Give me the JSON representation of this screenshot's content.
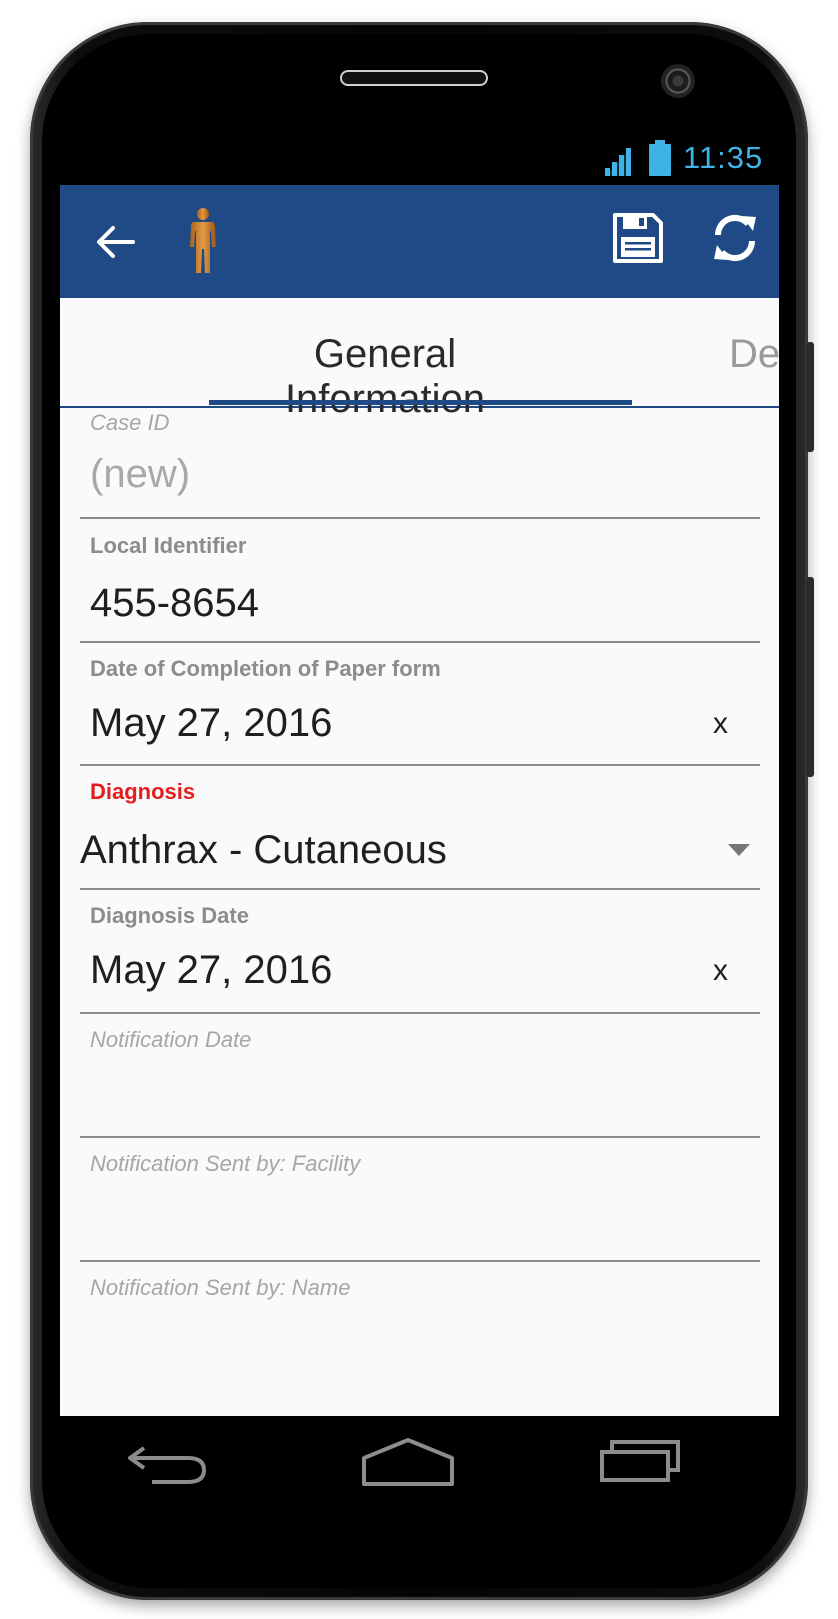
{
  "status_bar": {
    "time": "11:35",
    "time_color": "#3fb2e6"
  },
  "app_bar": {
    "color": "#204a85",
    "icons": [
      "back-arrow-icon",
      "person-icon",
      "save-icon",
      "sync-icon"
    ]
  },
  "tabs": {
    "active": "General Information",
    "next_partial": "De"
  },
  "form": {
    "case_id": {
      "label": "Case ID",
      "value": "(new)"
    },
    "local_identifier": {
      "label": "Local Identifier",
      "value": "455-8654"
    },
    "date_completion": {
      "label": "Date of Completion of Paper form",
      "value": "May 27, 2016",
      "clear": "x"
    },
    "diagnosis": {
      "label": "Diagnosis",
      "value": "Anthrax - Cutaneous",
      "label_color": "#e51c1c"
    },
    "diagnosis_date": {
      "label": "Diagnosis Date",
      "value": "May 27, 2016",
      "clear": "x"
    },
    "notification_date": {
      "label": "Notification Date",
      "value": ""
    },
    "notification_facility": {
      "label": "Notification Sent by: Facility",
      "value": ""
    },
    "notification_name": {
      "label": "Notification Sent by: Name",
      "value": ""
    }
  },
  "nav_bar": {
    "icons": [
      "back-nav-icon",
      "home-nav-icon",
      "recents-nav-icon"
    ]
  }
}
